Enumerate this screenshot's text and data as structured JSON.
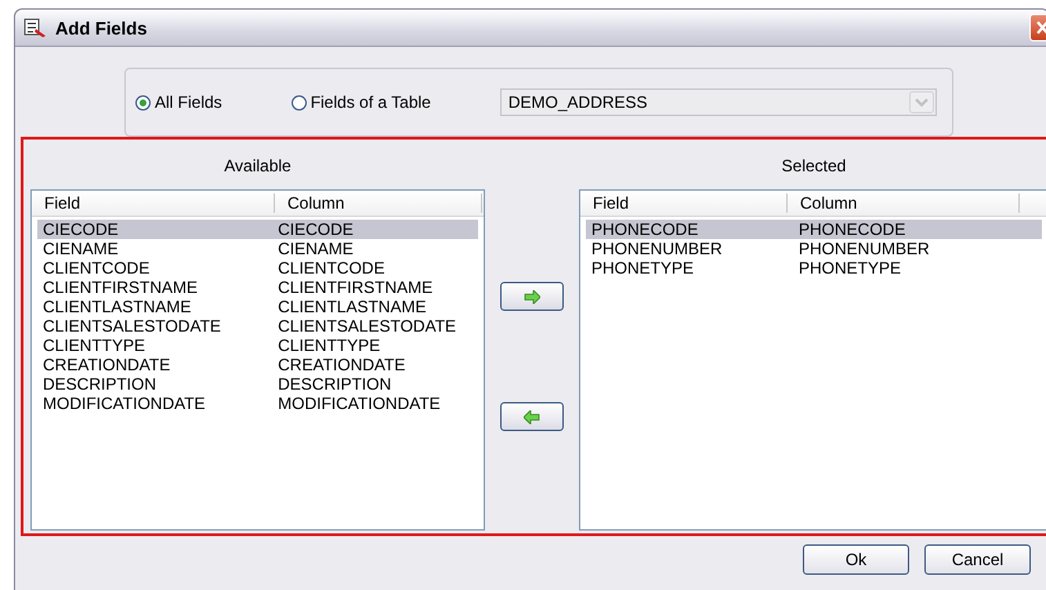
{
  "window": {
    "title": "Add Fields"
  },
  "source_options": [
    {
      "label": "All Fields",
      "selected": true
    },
    {
      "label": "Fields of a Table",
      "selected": false
    }
  ],
  "table_dropdown": {
    "value": "DEMO_ADDRESS",
    "disabled": true
  },
  "available": {
    "label": "Available",
    "columns": [
      "Field",
      "Column"
    ],
    "rows": [
      {
        "cells": [
          "CIECODE",
          "CIECODE"
        ],
        "selected": true
      },
      {
        "cells": [
          "CIENAME",
          "CIENAME"
        ],
        "selected": false
      },
      {
        "cells": [
          "CLIENTCODE",
          "CLIENTCODE"
        ],
        "selected": false
      },
      {
        "cells": [
          "CLIENTFIRSTNAME",
          "CLIENTFIRSTNAME"
        ],
        "selected": false
      },
      {
        "cells": [
          "CLIENTLASTNAME",
          "CLIENTLASTNAME"
        ],
        "selected": false
      },
      {
        "cells": [
          "CLIENTSALESTODATE",
          "CLIENTSALESTODATE"
        ],
        "selected": false
      },
      {
        "cells": [
          "CLIENTTYPE",
          "CLIENTTYPE"
        ],
        "selected": false
      },
      {
        "cells": [
          "CREATIONDATE",
          "CREATIONDATE"
        ],
        "selected": false
      },
      {
        "cells": [
          "DESCRIPTION",
          "DESCRIPTION"
        ],
        "selected": false
      },
      {
        "cells": [
          "MODIFICATIONDATE",
          "MODIFICATIONDATE"
        ],
        "selected": false
      }
    ]
  },
  "selected": {
    "label": "Selected",
    "columns": [
      "Field",
      "Column"
    ],
    "rows": [
      {
        "cells": [
          "PHONECODE",
          "PHONECODE"
        ],
        "selected": true
      },
      {
        "cells": [
          "PHONENUMBER",
          "PHONENUMBER"
        ],
        "selected": false
      },
      {
        "cells": [
          "PHONETYPE",
          "PHONETYPE"
        ],
        "selected": false
      }
    ]
  },
  "buttons": [
    "Ok",
    "Cancel"
  ]
}
